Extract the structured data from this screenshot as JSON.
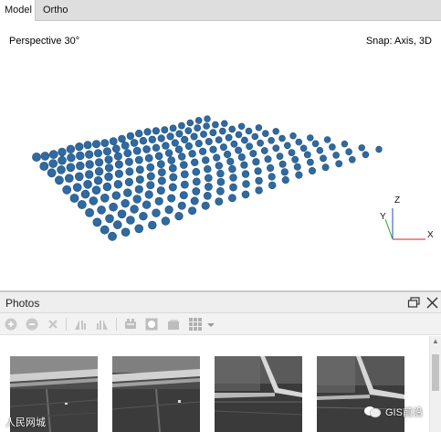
{
  "tabs": [
    {
      "label": "Model",
      "active": true
    },
    {
      "label": "Ortho",
      "active": false
    }
  ],
  "viewport": {
    "projection_label": "Perspective 30°",
    "snap_label": "Snap: Axis, 3D",
    "axes": {
      "x": "X",
      "y": "Y",
      "z": "Z"
    },
    "camera_grid": {
      "rows": 11,
      "cols": 21
    }
  },
  "photos_panel": {
    "title": "Photos",
    "toolbar_icons": [
      "add-photo-icon",
      "remove-photo-icon",
      "close-icon",
      "align-left-icon",
      "align-right-icon",
      "filter-icon",
      "mask-icon",
      "layer-icon",
      "grid-view-icon",
      "dropdown-icon"
    ],
    "thumbnail_count": 4
  },
  "watermarks": {
    "left": "人民网城",
    "right": "GIS前沿"
  },
  "colors": {
    "camera": "#2f6aa0",
    "axis_x": "#d22222",
    "axis_y": "#22aa22",
    "axis_z": "#2244cc"
  }
}
